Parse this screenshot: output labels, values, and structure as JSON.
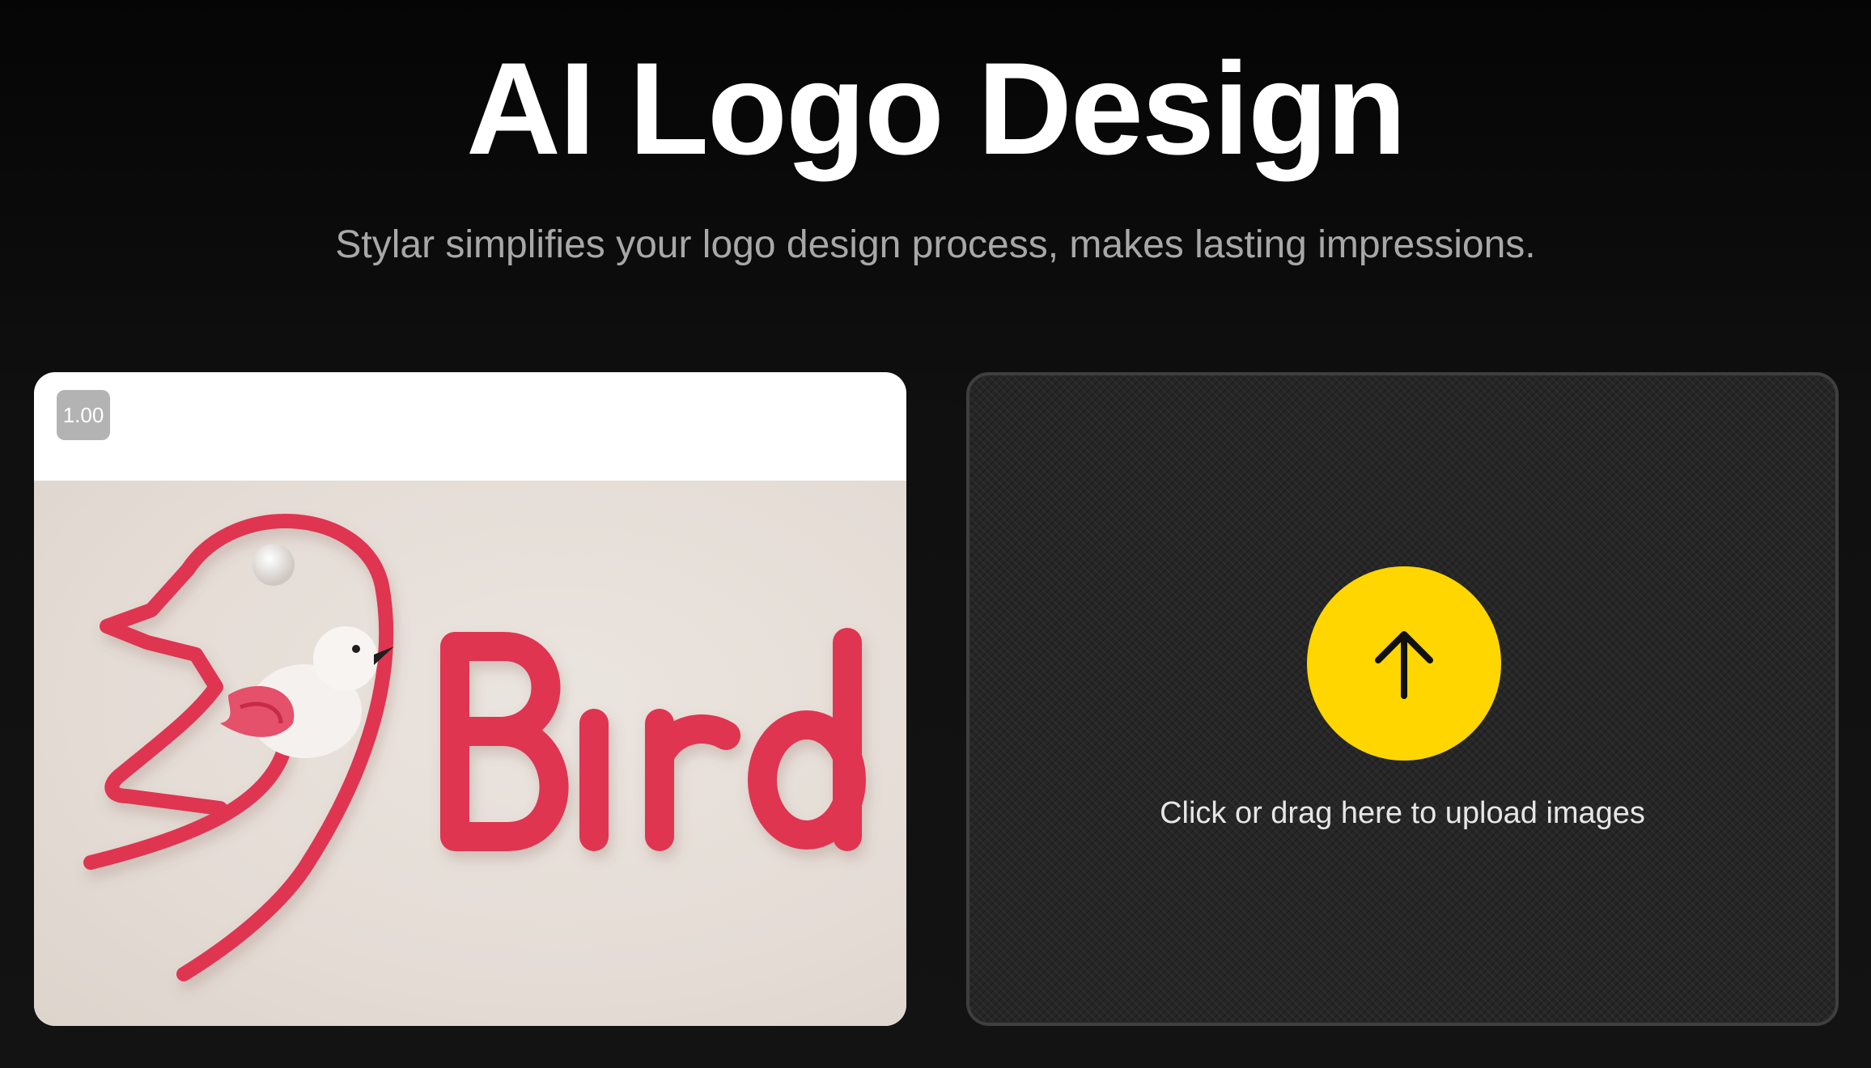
{
  "hero": {
    "title": "AI Logo Design",
    "subtitle": "Stylar simplifies your logo design process, makes lasting impressions."
  },
  "preview": {
    "zoom_label": "1.00",
    "logo_text": "Bird",
    "logo_color": "#e0344f"
  },
  "upload": {
    "hint": "Click or drag here to upload images",
    "button_color": "#ffd600",
    "icon": "arrow-up-icon"
  }
}
